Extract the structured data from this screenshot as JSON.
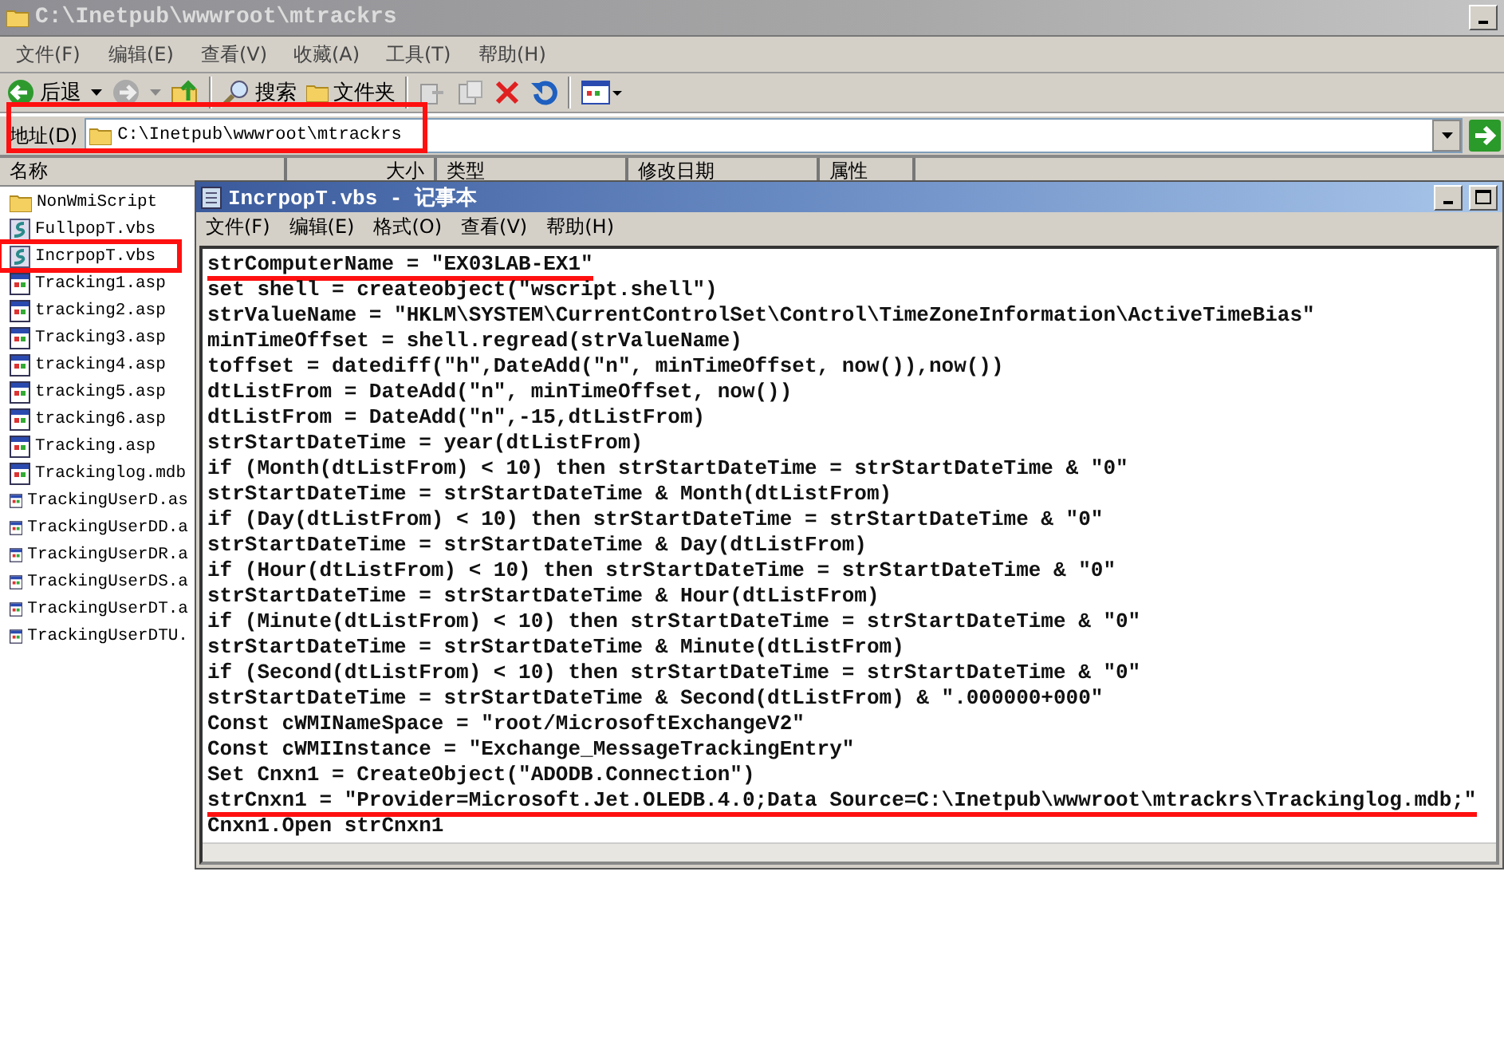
{
  "explorer": {
    "title": "C:\\Inetpub\\wwwroot\\mtrackrs",
    "menu": [
      "文件(F)",
      "编辑(E)",
      "查看(V)",
      "收藏(A)",
      "工具(T)",
      "帮助(H)"
    ],
    "toolbar": {
      "back": "后退",
      "search": "搜索",
      "folders": "文件夹"
    },
    "address": {
      "label": "地址(D)",
      "value": "C:\\Inetpub\\wwwroot\\mtrackrs",
      "highlighted": true
    },
    "columns": [
      "名称",
      "大小",
      "类型",
      "修改日期",
      "属性"
    ],
    "files": [
      {
        "name": "NonWmiScript",
        "kind": "folder",
        "highlighted": false
      },
      {
        "name": "FullpopT.vbs",
        "kind": "script",
        "highlighted": false
      },
      {
        "name": "IncrpopT.vbs",
        "kind": "script",
        "highlighted": true
      },
      {
        "name": "Tracking1.asp",
        "kind": "web",
        "highlighted": false
      },
      {
        "name": "tracking2.asp",
        "kind": "web",
        "highlighted": false
      },
      {
        "name": "Tracking3.asp",
        "kind": "web",
        "highlighted": false
      },
      {
        "name": "tracking4.asp",
        "kind": "web",
        "highlighted": false
      },
      {
        "name": "tracking5.asp",
        "kind": "web",
        "highlighted": false
      },
      {
        "name": "tracking6.asp",
        "kind": "web",
        "highlighted": false
      },
      {
        "name": "Tracking.asp",
        "kind": "web",
        "highlighted": false
      },
      {
        "name": "Trackinglog.mdb",
        "kind": "web",
        "highlighted": false
      },
      {
        "name": "TrackingUserD.as",
        "kind": "web",
        "highlighted": false
      },
      {
        "name": "TrackingUserDD.a",
        "kind": "web",
        "highlighted": false
      },
      {
        "name": "TrackingUserDR.a",
        "kind": "web",
        "highlighted": false
      },
      {
        "name": "TrackingUserDS.a",
        "kind": "web",
        "highlighted": false
      },
      {
        "name": "TrackingUserDT.a",
        "kind": "web",
        "highlighted": false
      },
      {
        "name": "TrackingUserDTU.",
        "kind": "web",
        "highlighted": false
      }
    ]
  },
  "notepad": {
    "title": "IncrpopT.vbs - 记事本",
    "menu": [
      "文件(F)",
      "编辑(E)",
      "格式(O)",
      "查看(V)",
      "帮助(H)"
    ],
    "lines": [
      {
        "text": "strComputerName = \"EX03LAB-EX1\"",
        "underlined": true
      },
      {
        "text": "set shell = createobject(\"wscript.shell\")",
        "underlined": false
      },
      {
        "text": "strValueName = \"HKLM\\SYSTEM\\CurrentControlSet\\Control\\TimeZoneInformation\\ActiveTimeBias\"",
        "underlined": false
      },
      {
        "text": "minTimeOffset = shell.regread(strValueName)",
        "underlined": false
      },
      {
        "text": "toffset = datediff(\"h\",DateAdd(\"n\", minTimeOffset, now()),now())",
        "underlined": false
      },
      {
        "text": "dtListFrom = DateAdd(\"n\", minTimeOffset, now())",
        "underlined": false
      },
      {
        "text": "dtListFrom = DateAdd(\"n\",-15,dtListFrom)",
        "underlined": false
      },
      {
        "text": "strStartDateTime = year(dtListFrom)",
        "underlined": false
      },
      {
        "text": "if (Month(dtListFrom) < 10) then strStartDateTime = strStartDateTime & \"0\"",
        "underlined": false
      },
      {
        "text": "strStartDateTime = strStartDateTime & Month(dtListFrom)",
        "underlined": false
      },
      {
        "text": "if (Day(dtListFrom) < 10) then strStartDateTime = strStartDateTime & \"0\"",
        "underlined": false
      },
      {
        "text": "strStartDateTime = strStartDateTime & Day(dtListFrom)",
        "underlined": false
      },
      {
        "text": "if (Hour(dtListFrom) < 10) then strStartDateTime = strStartDateTime & \"0\"",
        "underlined": false
      },
      {
        "text": "strStartDateTime = strStartDateTime & Hour(dtListFrom)",
        "underlined": false
      },
      {
        "text": "if (Minute(dtListFrom) < 10) then strStartDateTime = strStartDateTime & \"0\"",
        "underlined": false
      },
      {
        "text": "strStartDateTime = strStartDateTime & Minute(dtListFrom)",
        "underlined": false
      },
      {
        "text": "if (Second(dtListFrom) < 10) then strStartDateTime = strStartDateTime & \"0\"",
        "underlined": false
      },
      {
        "text": "strStartDateTime = strStartDateTime & Second(dtListFrom) & \".000000+000\"",
        "underlined": false
      },
      {
        "text": "Const cWMINameSpace = \"root/MicrosoftExchangeV2\"",
        "underlined": false
      },
      {
        "text": "Const cWMIInstance = \"Exchange_MessageTrackingEntry\"",
        "underlined": false
      },
      {
        "text": "Set Cnxn1 = CreateObject(\"ADODB.Connection\")",
        "underlined": false
      },
      {
        "text": "strCnxn1 = \"Provider=Microsoft.Jet.OLEDB.4.0;Data Source=C:\\Inetpub\\wwwroot\\mtrackrs\\Trackinglog.mdb;\"",
        "underlined": true
      },
      {
        "text": "Cnxn1.Open strCnxn1",
        "underlined": false
      }
    ]
  }
}
